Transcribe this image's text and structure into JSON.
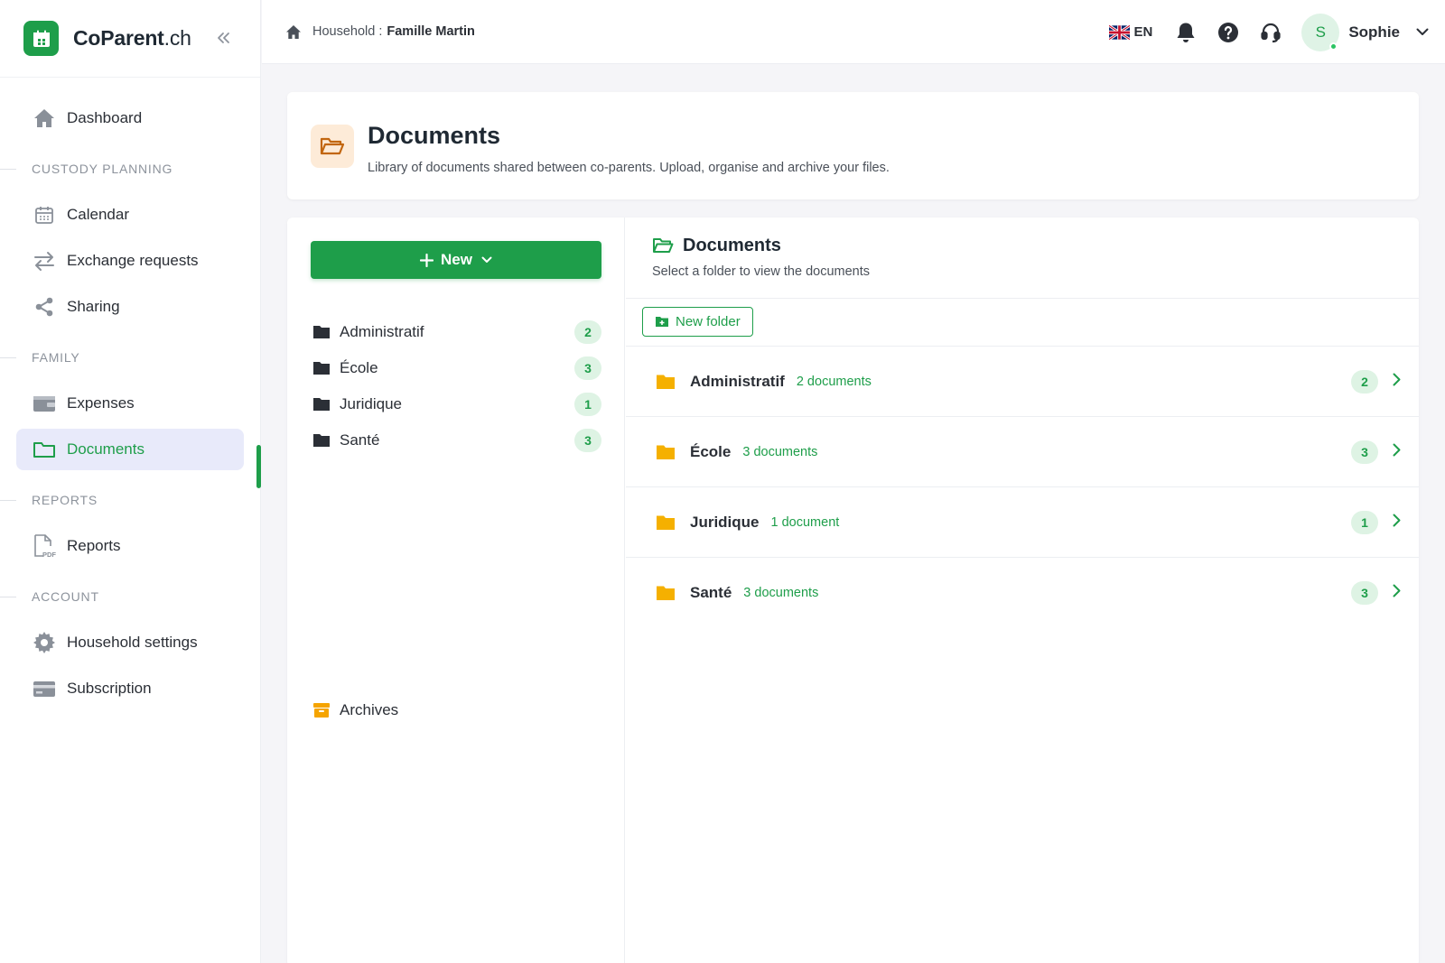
{
  "brand": {
    "name": "CoParent",
    "tld": ".ch",
    "color": "#1e9e4a"
  },
  "sidebar": {
    "items": [
      {
        "type": "item",
        "label": "Dashboard",
        "icon": "home-icon"
      },
      {
        "type": "section",
        "label": "CUSTODY PLANNING"
      },
      {
        "type": "item",
        "label": "Calendar",
        "icon": "calendar-icon"
      },
      {
        "type": "item",
        "label": "Exchange requests",
        "icon": "swap-arrows-icon"
      },
      {
        "type": "item",
        "label": "Sharing",
        "icon": "share-icon"
      },
      {
        "type": "section",
        "label": "FAMILY"
      },
      {
        "type": "item",
        "label": "Expenses",
        "icon": "wallet-icon"
      },
      {
        "type": "item",
        "label": "Documents",
        "icon": "folder-icon",
        "active": true
      },
      {
        "type": "section",
        "label": "REPORTS"
      },
      {
        "type": "item",
        "label": "Reports",
        "icon": "pdf-file-icon"
      },
      {
        "type": "section",
        "label": "ACCOUNT"
      },
      {
        "type": "item",
        "label": "Household settings",
        "icon": "gear-icon"
      },
      {
        "type": "item",
        "label": "Subscription",
        "icon": "credit-card-icon"
      }
    ]
  },
  "topbar": {
    "breadcrumb_prefix": "Household :",
    "household_name": "Famille Martin",
    "language": "EN",
    "user": {
      "initial": "S",
      "name": "Sophie"
    }
  },
  "header": {
    "title": "Documents",
    "subtitle": "Library of documents shared between co-parents. Upload, organise and archive your files."
  },
  "left_pane": {
    "new_button": "New",
    "folders": [
      {
        "name": "Administratif",
        "count": "2"
      },
      {
        "name": "École",
        "count": "3"
      },
      {
        "name": "Juridique",
        "count": "1"
      },
      {
        "name": "Santé",
        "count": "3"
      }
    ],
    "archives_label": "Archives"
  },
  "right_pane": {
    "title": "Documents",
    "subtitle": "Select a folder to view the documents",
    "new_folder_button": "New folder",
    "rows": [
      {
        "name": "Administratif",
        "doc_count_text": "2 documents",
        "count": "2"
      },
      {
        "name": "École",
        "doc_count_text": "3 documents",
        "count": "3"
      },
      {
        "name": "Juridique",
        "doc_count_text": "1 document",
        "count": "1"
      },
      {
        "name": "Santé",
        "doc_count_text": "3 documents",
        "count": "3"
      }
    ]
  },
  "colors": {
    "accent": "#1e9e4a",
    "folder_yellow": "#f5b000",
    "badge_bg": "#def3e4",
    "active_nav_bg": "#e8eafa"
  }
}
